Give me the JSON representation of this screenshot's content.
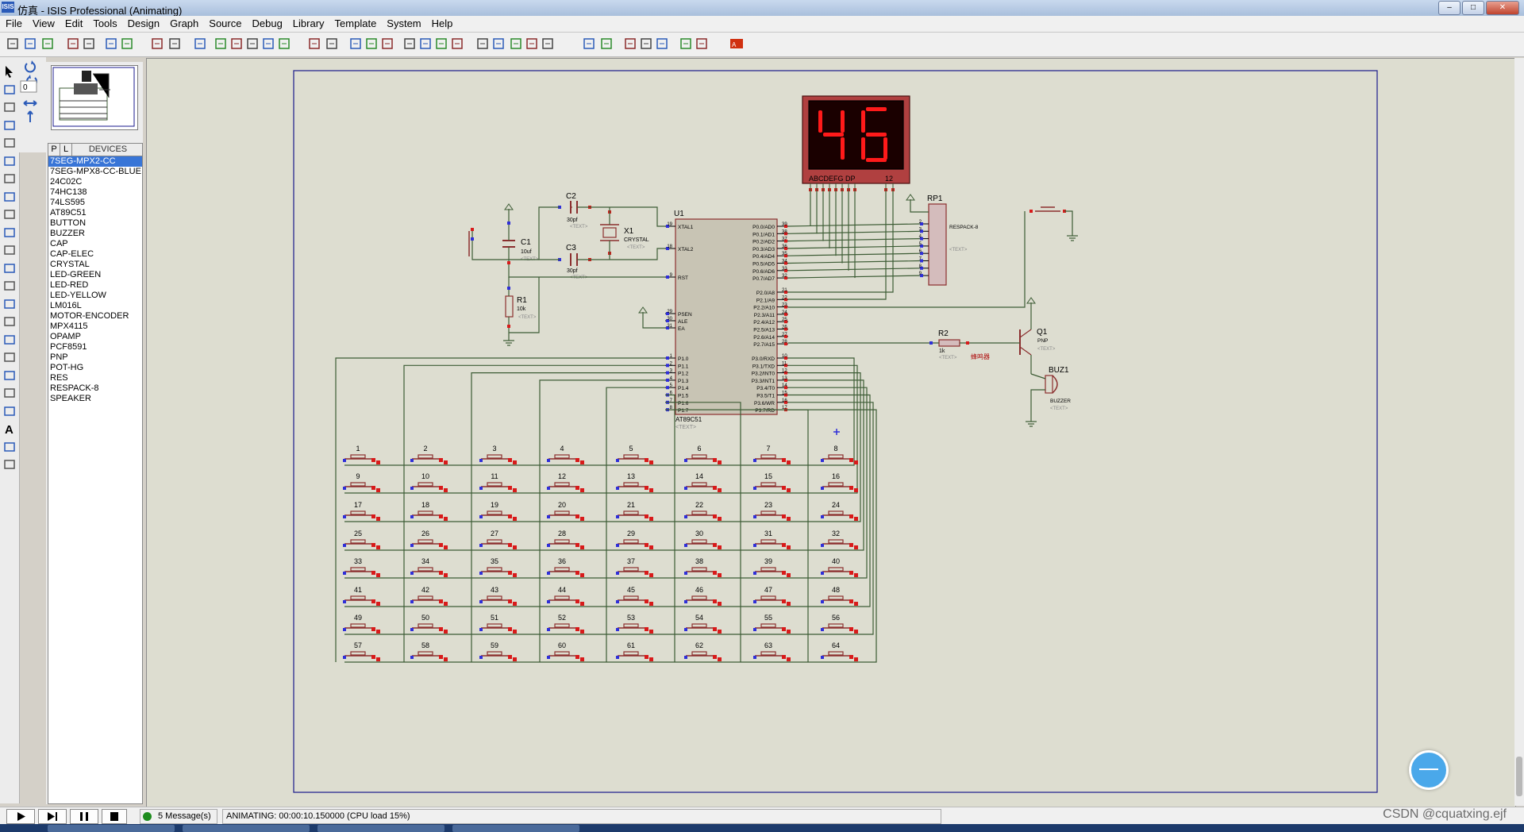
{
  "window": {
    "title": "仿真 - ISIS Professional (Animating)",
    "app_icon": "ISIS"
  },
  "menu": [
    "File",
    "View",
    "Edit",
    "Tools",
    "Design",
    "Graph",
    "Source",
    "Debug",
    "Library",
    "Template",
    "System",
    "Help"
  ],
  "panel": {
    "tab_p": "P",
    "tab_l": "L",
    "devices_header": "DEVICES",
    "rotation_value": "0",
    "devices": [
      "7SEG-MPX2-CC",
      "7SEG-MPX8-CC-BLUE",
      "24C02C",
      "74HC138",
      "74LS595",
      "AT89C51",
      "BUTTON",
      "BUZZER",
      "CAP",
      "CAP-ELEC",
      "CRYSTAL",
      "LED-GREEN",
      "LED-RED",
      "LED-YELLOW",
      "LM016L",
      "MOTOR-ENCODER",
      "MPX4115",
      "OPAMP",
      "PCF8591",
      "PNP",
      "POT-HG",
      "RES",
      "RESPACK-8",
      "SPEAKER"
    ],
    "selected_device": "7SEG-MPX2-CC"
  },
  "schematic": {
    "display": {
      "digits": "46",
      "pin_label_left": "ABCDEFG  DP",
      "pin_label_right": "12"
    },
    "u1": {
      "ref": "U1",
      "part": "AT89C51",
      "text": "<TEXT>",
      "left_top_pins": [
        {
          "num": "19",
          "name": "XTAL1"
        },
        {
          "num": "18",
          "name": "XTAL2"
        },
        {
          "num": "9",
          "name": "RST"
        }
      ],
      "left_mid_pins": [
        {
          "num": "29",
          "name": "PSEN"
        },
        {
          "num": "30",
          "name": "ALE"
        },
        {
          "num": "31",
          "name": "EA"
        }
      ],
      "left_p1_pins": [
        {
          "num": "1",
          "name": "P1.0"
        },
        {
          "num": "2",
          "name": "P1.1"
        },
        {
          "num": "3",
          "name": "P1.2"
        },
        {
          "num": "4",
          "name": "P1.3"
        },
        {
          "num": "5",
          "name": "P1.4"
        },
        {
          "num": "6",
          "name": "P1.5"
        },
        {
          "num": "7",
          "name": "P1.6"
        },
        {
          "num": "8",
          "name": "P1.7"
        }
      ],
      "right_p0_pins": [
        {
          "num": "39",
          "name": "P0.0/AD0"
        },
        {
          "num": "38",
          "name": "P0.1/AD1"
        },
        {
          "num": "37",
          "name": "P0.2/AD2"
        },
        {
          "num": "36",
          "name": "P0.3/AD3"
        },
        {
          "num": "35",
          "name": "P0.4/AD4"
        },
        {
          "num": "34",
          "name": "P0.5/AD5"
        },
        {
          "num": "33",
          "name": "P0.6/AD6"
        },
        {
          "num": "32",
          "name": "P0.7/AD7"
        }
      ],
      "right_p2_pins": [
        {
          "num": "21",
          "name": "P2.0/A8"
        },
        {
          "num": "22",
          "name": "P2.1/A9"
        },
        {
          "num": "23",
          "name": "P2.2/A10"
        },
        {
          "num": "24",
          "name": "P2.3/A11"
        },
        {
          "num": "25",
          "name": "P2.4/A12"
        },
        {
          "num": "26",
          "name": "P2.5/A13"
        },
        {
          "num": "27",
          "name": "P2.6/A14"
        },
        {
          "num": "28",
          "name": "P2.7/A15"
        }
      ],
      "right_p3_pins": [
        {
          "num": "10",
          "name": "P3.0/RXD"
        },
        {
          "num": "11",
          "name": "P3.1/TXD"
        },
        {
          "num": "12",
          "name": "P3.2/INT0"
        },
        {
          "num": "13",
          "name": "P3.3/INT1"
        },
        {
          "num": "14",
          "name": "P3.4/T0"
        },
        {
          "num": "15",
          "name": "P3.5/T1"
        },
        {
          "num": "16",
          "name": "P3.6/WR"
        },
        {
          "num": "17",
          "name": "P3.7/RD"
        }
      ]
    },
    "c1": {
      "ref": "C1",
      "value": "10uf",
      "text": "<TEXT>"
    },
    "c2": {
      "ref": "C2",
      "value": "30pf",
      "text": "<TEXT>"
    },
    "c3": {
      "ref": "C3",
      "value": "30pf",
      "text": "<TEXT>"
    },
    "x1": {
      "ref": "X1",
      "value": "CRYSTAL",
      "text": "<TEXT>"
    },
    "r1": {
      "ref": "R1",
      "value": "10k",
      "text": "<TEXT>"
    },
    "r2": {
      "ref": "R2",
      "value": "1k",
      "text": "<TEXT>"
    },
    "rp1": {
      "ref": "RP1",
      "value": "RESPACK-8",
      "text": "<TEXT>",
      "pins": [
        "2",
        "3",
        "4",
        "5",
        "6",
        "7",
        "8",
        "9"
      ]
    },
    "q1": {
      "ref": "Q1",
      "value": "PNP",
      "text": "<TEXT>"
    },
    "buz1": {
      "ref": "BUZ1",
      "value": "BUZZER",
      "text": "<TEXT>"
    },
    "net_label": "蜂鸣器",
    "button_labels": [
      "1",
      "2",
      "3",
      "4",
      "5",
      "6",
      "7",
      "8",
      "9",
      "10",
      "11",
      "12",
      "13",
      "14",
      "15",
      "16",
      "17",
      "18",
      "19",
      "20",
      "21",
      "22",
      "23",
      "24",
      "25",
      "26",
      "27",
      "28",
      "29",
      "30",
      "31",
      "32",
      "33",
      "34",
      "35",
      "36",
      "37",
      "38",
      "39",
      "40",
      "41",
      "42",
      "43",
      "44",
      "45",
      "46",
      "47",
      "48",
      "49",
      "50",
      "51",
      "52",
      "53",
      "54",
      "55",
      "56",
      "57",
      "58",
      "59",
      "60",
      "61",
      "62",
      "63",
      "64"
    ]
  },
  "status": {
    "messages": "5 Message(s)",
    "animating": "ANIMATING: 00:00:10.150000 (CPU load 15%)"
  },
  "watermark": "CSDN @cquatxing.ejf",
  "colors": {
    "wire": "#3d5c35",
    "component": "#8b2e2e",
    "chip_fill": "#c8c4b4",
    "display_bg": "#b04040",
    "segment_on": "#ff1a1a",
    "canvas": "#ddddd0",
    "border": "#1a1a8c"
  }
}
